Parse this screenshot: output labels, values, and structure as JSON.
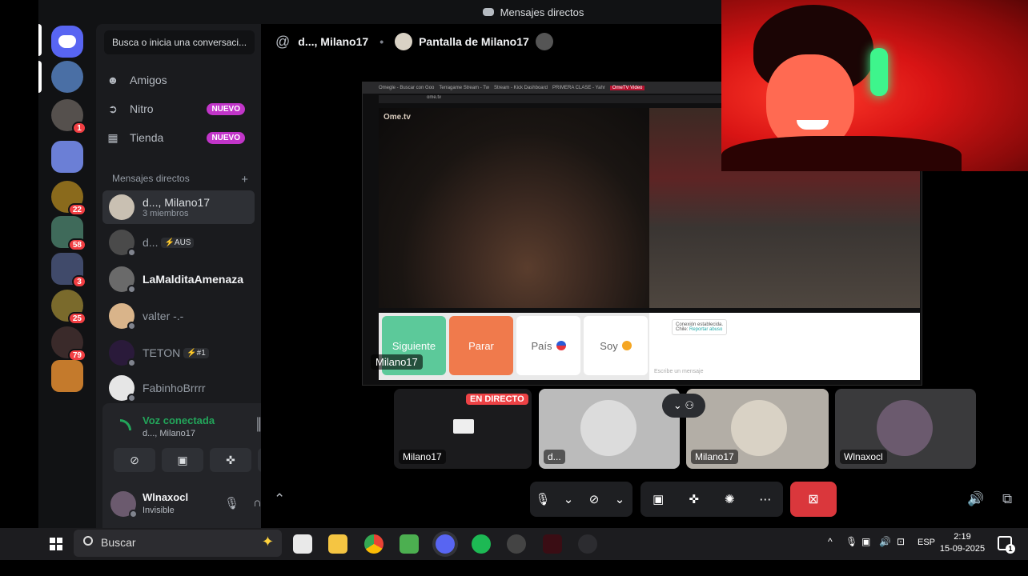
{
  "window": {
    "title": "Mensajes directos"
  },
  "sidebar": {
    "search_placeholder": "Busca o inicia una conversaci...",
    "nav": [
      {
        "label": "Amigos",
        "icon": "friends-icon"
      },
      {
        "label": "Nitro",
        "icon": "nitro-icon",
        "badge": "NUEVO"
      },
      {
        "label": "Tienda",
        "icon": "shop-icon",
        "badge": "NUEVO"
      }
    ],
    "dm_header": "Mensajes directos",
    "dm_add": "+",
    "dms": [
      {
        "name": "d..., Milano17",
        "sub": "3 miembros",
        "active": true
      },
      {
        "name": "d...",
        "tag": "⚡AUS"
      },
      {
        "name": "LaMalditaAmenaza"
      },
      {
        "name": "valter -.-"
      },
      {
        "name": "TETON",
        "tag": "⚡#1"
      },
      {
        "name": "FabinhoBrrrr"
      }
    ]
  },
  "servers": {
    "badges": [
      "1",
      "22",
      "58",
      "3",
      "25",
      "79"
    ]
  },
  "voice": {
    "status": "Voz conectada",
    "channel": "d..., Milano17"
  },
  "user": {
    "name": "Wlnaxocl",
    "status": "Invisible"
  },
  "header": {
    "at": "@",
    "channel": "d..., Milano17",
    "stream_title": "Pantalla de Milano17"
  },
  "stream": {
    "tabs": [
      "Omegle - Buscar con Goo",
      "Terragame Stream - Tw",
      "Stream - Kick Dashboard",
      "PRIMERA CLASE - Yahr",
      "OmeTV Video"
    ],
    "url": "ome.tv",
    "logo": "Ome.tv",
    "buttons": {
      "next": "Siguiente",
      "stop": "Parar",
      "country": "País",
      "gender": "Soy"
    },
    "chat_msg": "Conexión establecida.",
    "chat_country": "Chile:",
    "chat_report": "Reportar abuso",
    "chat_input": "Escribe un mensaje",
    "presenter": "Milano17"
  },
  "tiles": [
    {
      "label": "Milano17",
      "live": "EN DIRECTO"
    },
    {
      "label": "d..."
    },
    {
      "label": "Milano17"
    },
    {
      "label": "Wlnaxocl"
    }
  ],
  "taskbar": {
    "search": "Buscar",
    "lang": "ESP",
    "time": "2:19",
    "date": "15-09-2025",
    "notifications": "1"
  },
  "colors": {
    "accent": "#5865f2",
    "voice_green": "#23a55a",
    "danger": "#da373c",
    "nitro_badge": "#c135c9",
    "next_btn": "#5cc99a",
    "stop_btn": "#f07a4c"
  }
}
